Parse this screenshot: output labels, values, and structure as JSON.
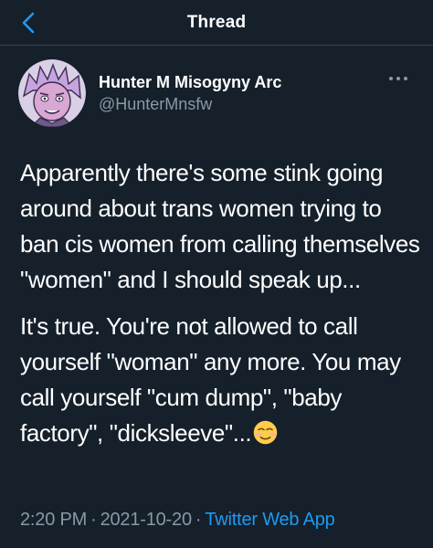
{
  "header": {
    "title": "Thread",
    "back_icon": "chevron-left-icon",
    "accent": "#1d9bf0"
  },
  "author": {
    "display_name": "Hunter M Misogyny Arc",
    "handle": "@HunterMnsfw",
    "avatar_icon": "avatar-illustration",
    "more_icon": "more-horizontal-icon"
  },
  "tweet": {
    "paragraphs": [
      "Apparently there's some stink going around about trans women trying to ban cis women from calling themselves \"women\" and I should speak up...",
      "It's true. You're not allowed to call yourself \"woman\" any more. You may call yourself \"cum dump\", \"baby factory\", \"dicksleeve\"..."
    ],
    "emoji": "☺️"
  },
  "meta": {
    "time": "2:20 PM",
    "separator": "·",
    "date": "2021-10-20",
    "source": "Twitter Web App"
  },
  "colors": {
    "background": "#15202b",
    "text": "#ffffff",
    "secondary": "#8b98a5",
    "link": "#1d9bf0",
    "divider": "#38444d"
  }
}
